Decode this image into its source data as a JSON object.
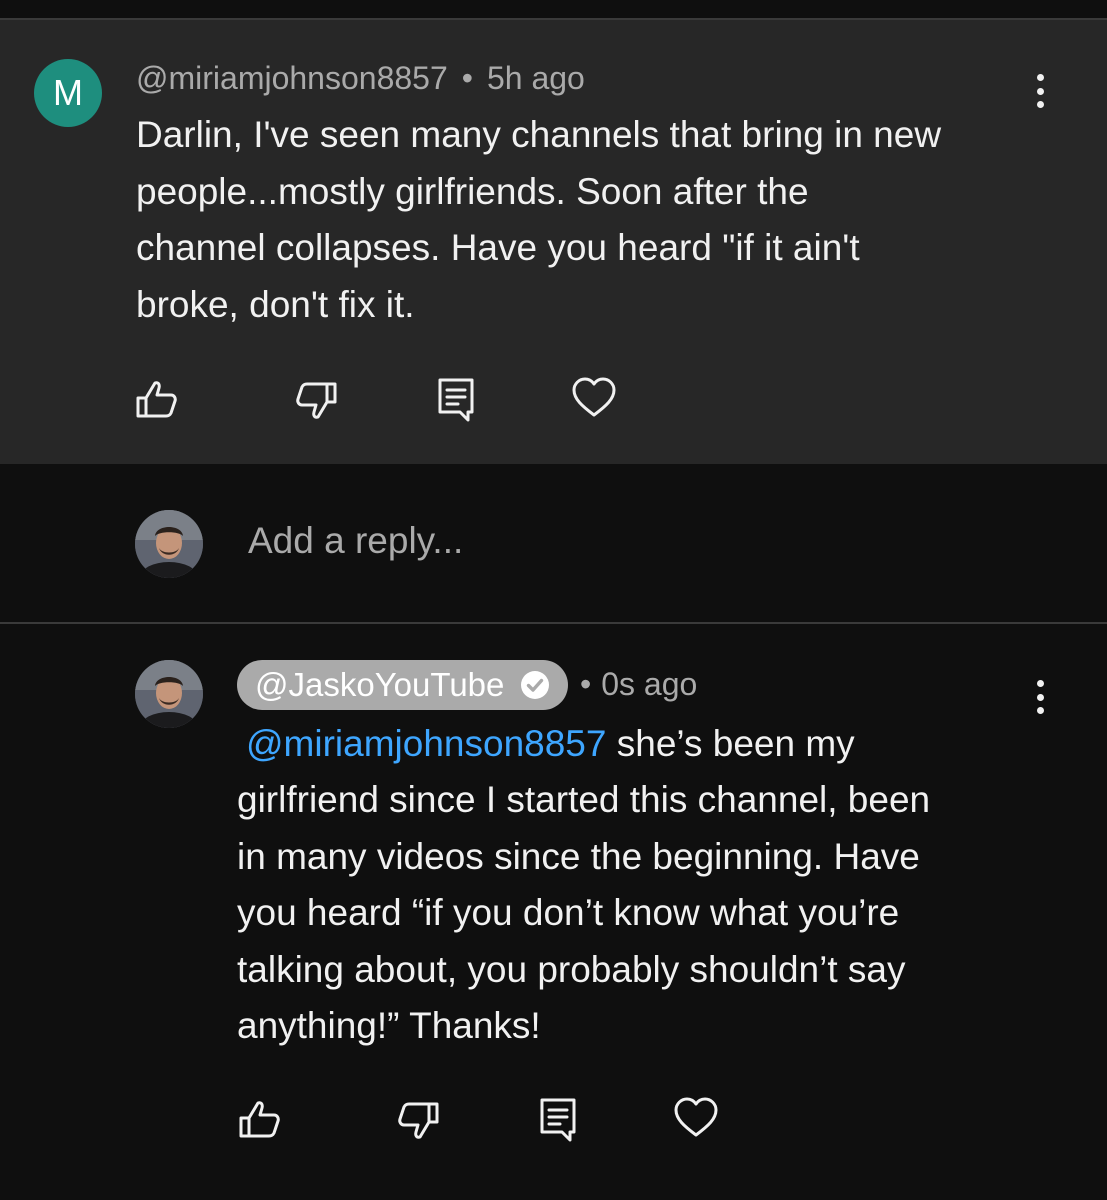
{
  "first_comment": {
    "avatar_letter": "M",
    "author": "@miriamjohnson8857",
    "separator": "•",
    "time": "5h ago",
    "text": "Darlin, I've seen many channels that bring in new\npeople...mostly girlfriends.  Soon after the\nchannel collapses.  Have you heard \"if it ain't\nbroke, don't fix it.",
    "actions": [
      "like",
      "dislike",
      "reply",
      "heart"
    ]
  },
  "reply_box": {
    "placeholder": "Add a reply..."
  },
  "reply_comment": {
    "author": "@JaskoYouTube",
    "verified": true,
    "separator": "•",
    "time": "0s ago",
    "mention": "@miriamjohnson8857",
    "text_after_mention": "  she’s been my",
    "text": "girlfriend since I started this channel, been\nin many videos since the beginning. Have\nyou heard “if you don’t know what you’re\ntalking about, you probably shouldn’t say\nanything!” Thanks!",
    "actions": [
      "like",
      "dislike",
      "reply",
      "heart"
    ]
  },
  "colors": {
    "background": "#0f0f0f",
    "card": "#272727",
    "avatar_letter_bg": "#1e8e7e",
    "mention": "#3ea6ff",
    "pill": "#aaaaaa",
    "meta": "#aaaaaa"
  }
}
